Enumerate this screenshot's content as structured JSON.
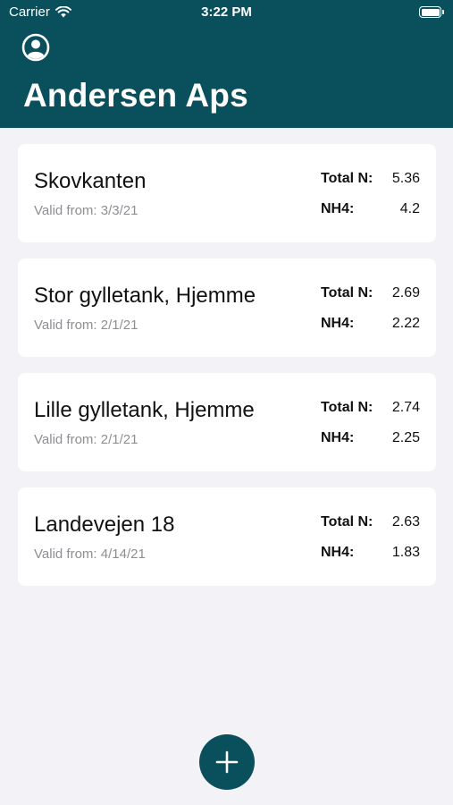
{
  "status_bar": {
    "carrier": "Carrier",
    "time": "3:22 PM"
  },
  "header": {
    "title": "Andersen Aps",
    "background_color": "#0a4f5c",
    "profile_icon": "person-circle-icon"
  },
  "labels": {
    "valid_from": "Valid from:",
    "total_n": "Total N:",
    "nh4": "NH4:"
  },
  "tanks": [
    {
      "name": "Skovkanten",
      "valid_from": "Valid from: 3/3/21",
      "total_n_label": "Total N:",
      "total_n": "5.36",
      "nh4_label": "NH4:",
      "nh4": "4.2"
    },
    {
      "name": "Stor gylletank, Hjemme",
      "valid_from": "Valid from: 2/1/21",
      "total_n_label": "Total N:",
      "total_n": "2.69",
      "nh4_label": "NH4:",
      "nh4": "2.22"
    },
    {
      "name": "Lille gylletank, Hjemme",
      "valid_from": "Valid from: 2/1/21",
      "total_n_label": "Total N:",
      "total_n": "2.74",
      "nh4_label": "NH4:",
      "nh4": "2.25"
    },
    {
      "name": "Landevejen 18",
      "valid_from": "Valid from: 4/14/21",
      "total_n_label": "Total N:",
      "total_n": "2.63",
      "nh4_label": "NH4:",
      "nh4": "1.83"
    }
  ],
  "fab": {
    "icon": "plus-icon",
    "color": "#0a4f5c"
  }
}
